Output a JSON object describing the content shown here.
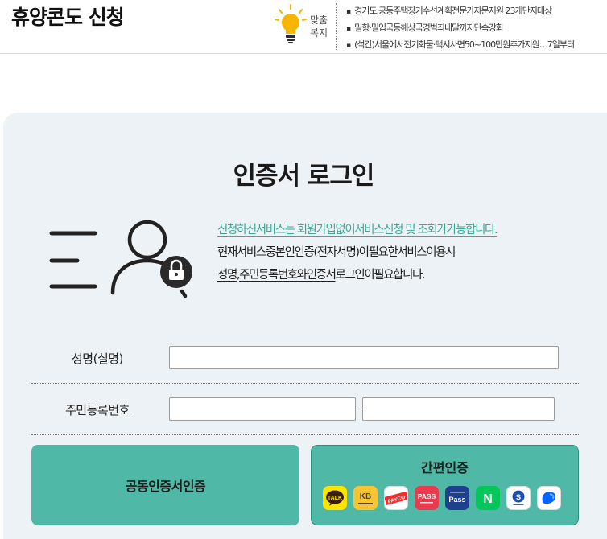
{
  "header": {
    "site_title": "휴양콘도 신청",
    "custom_welfare_label": "맞춤 복지",
    "news": [
      "경기도,공동주택장기수선계획전문가자문지원 23개단지대상",
      "밀항·밀입국등해상국경범죄내달까지단속강화",
      "(석간)서울에서전기화물·택시사면50~100만원추가지원…7일부터"
    ]
  },
  "login": {
    "title": "인증서 로그인",
    "desc_line1": "신청하신서비스는 회원가입없이서비스신청 및 조회가가능합니다.",
    "desc_line2": "현재서비스중본인인증(전자서명)이필요한서비스이용시",
    "desc_line3_part1": "성명",
    "desc_line3_sep": ",",
    "desc_line3_part2": "주민등록번호와인증서",
    "desc_line3_part3": "로그인이필요합니다."
  },
  "form": {
    "name_label": "성명(실명)",
    "rrn_label": "주민등록번호"
  },
  "buttons": {
    "joint_cert": "공동인증서인증",
    "simple_auth": "간편인증"
  },
  "providers": [
    {
      "name": "kakao",
      "label": "TALK",
      "color": "#fee500"
    },
    {
      "name": "kb",
      "label": "KB",
      "color": "#f7c531"
    },
    {
      "name": "payco",
      "label": "PAYCO",
      "color": "#ffffff"
    },
    {
      "name": "pass",
      "label": "PASS",
      "color": "#e93a4e"
    },
    {
      "name": "samsung-pass",
      "label": "Pass",
      "color": "#1f3f8f"
    },
    {
      "name": "naver",
      "label": "N",
      "color": "#03c75a"
    },
    {
      "name": "shinhan",
      "label": "S",
      "color": "#ffffff"
    },
    {
      "name": "toss",
      "label": "",
      "color": "#ffffff"
    }
  ],
  "colors": {
    "accent": "#4fb8a6",
    "highlight_text": "#3aaa95",
    "card_bg": "#edf2f6"
  }
}
